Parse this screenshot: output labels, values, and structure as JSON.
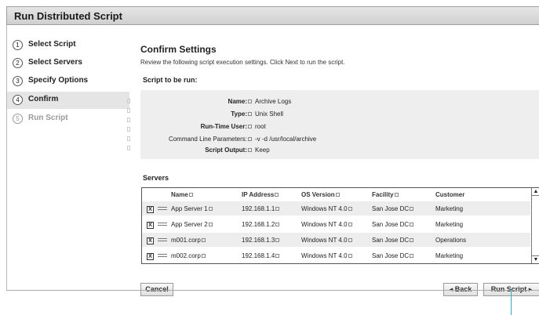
{
  "window": {
    "title": "Run Distributed Script"
  },
  "steps": [
    {
      "num": "1",
      "label": "Select Script",
      "state": "done"
    },
    {
      "num": "2",
      "label": "Select Servers",
      "state": "done"
    },
    {
      "num": "3",
      "label": "Specify Options",
      "state": "done"
    },
    {
      "num": "4",
      "label": "Confirm",
      "state": "active"
    },
    {
      "num": "5",
      "label": "Run Script",
      "state": "disabled"
    }
  ],
  "main": {
    "heading": "Confirm Settings",
    "intro": "Review the following script execution settings. Click Next to run the script.",
    "script_section": "Script to be run:",
    "settings": [
      {
        "key": "Name:",
        "value": "Archive Logs",
        "bold": true
      },
      {
        "key": "Type:",
        "value": "Unix Shell",
        "bold": true
      },
      {
        "key": "Run-Time User:",
        "value": "root",
        "bold": true
      },
      {
        "key": "Command Line Parameters:",
        "value": "-v -d /usr/local/archive",
        "bold": false
      },
      {
        "key": "Script Output:",
        "value": "Keep",
        "bold": true
      }
    ],
    "servers_section": "Servers",
    "table": {
      "columns": [
        "Name",
        "IP Address",
        "OS Version",
        "Facility",
        "Customer"
      ],
      "rows": [
        {
          "name": "App Server 1",
          "ip": "192.168.1.1",
          "os": "Windows NT 4.0",
          "facility": "San Jose DC",
          "customer": "Marketing",
          "checked": true
        },
        {
          "name": "App Server 2",
          "ip": "192.168.1.2",
          "os": "Windows NT 4.0",
          "facility": "San Jose DC",
          "customer": "Marketing",
          "checked": true
        },
        {
          "name": "m001.corp",
          "ip": "192.168.1.3",
          "os": "Windows NT 4.0",
          "facility": "San Jose DC",
          "customer": "Operations",
          "checked": true
        },
        {
          "name": "m002.corp",
          "ip": "192.168.1.4",
          "os": "Windows NT 4.0",
          "facility": "San Jose DC",
          "customer": "Marketing",
          "checked": true
        }
      ],
      "check_glyph": "X"
    }
  },
  "buttons": {
    "cancel": "Cancel",
    "back": "Back",
    "run": "Run Script"
  },
  "icons": {
    "back": "chevron-left-icon",
    "run": "chevron-right-icon",
    "scroll_up": "scroll-up-icon",
    "scroll_down": "scroll-down-icon",
    "row": "server-row-icon"
  },
  "colors": {
    "active_step": "#e5e5e5",
    "settings_bg": "#eeeeee",
    "alt_row": "#ededed",
    "callout": "#3aa6b9"
  }
}
